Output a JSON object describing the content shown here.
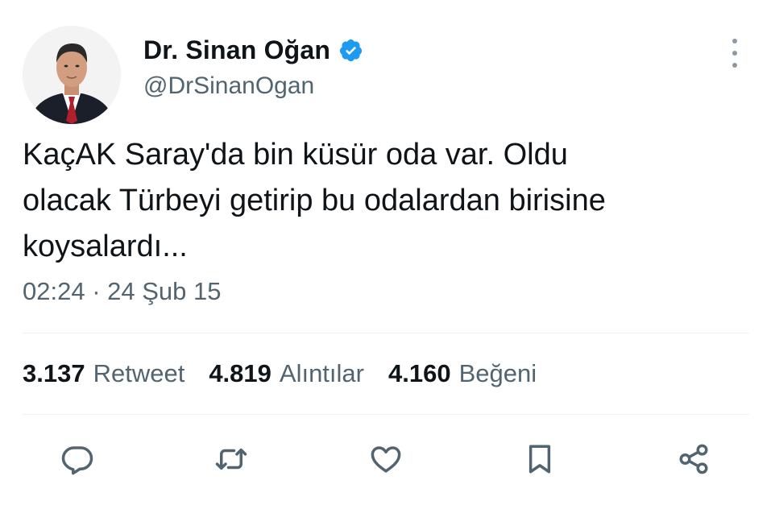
{
  "author": {
    "name": "Dr. Sinan Oğan",
    "handle": "@DrSinanOgan",
    "verified": true,
    "verified_color": "#1d9bf0"
  },
  "tweet": {
    "lines": [
      "KaçAK Saray'da bin küsür oda var. Oldu",
      "olacak Türbeyi getirip bu odalardan birisine",
      "koysalardı..."
    ],
    "timestamp": "02:24 · 24 Şub 15"
  },
  "stats": [
    {
      "value": "3.137",
      "label": "Retweet"
    },
    {
      "value": "4.819",
      "label": "Alıntılar"
    },
    {
      "value": "4.160",
      "label": "Beğeni"
    }
  ],
  "actions": [
    {
      "icon": "reply-icon"
    },
    {
      "icon": "retweet-icon"
    },
    {
      "icon": "like-icon"
    },
    {
      "icon": "bookmark-icon"
    },
    {
      "icon": "share-icon"
    }
  ],
  "colors": {
    "text": "#0f1419",
    "muted": "#536471",
    "divider": "#eff3f4"
  }
}
